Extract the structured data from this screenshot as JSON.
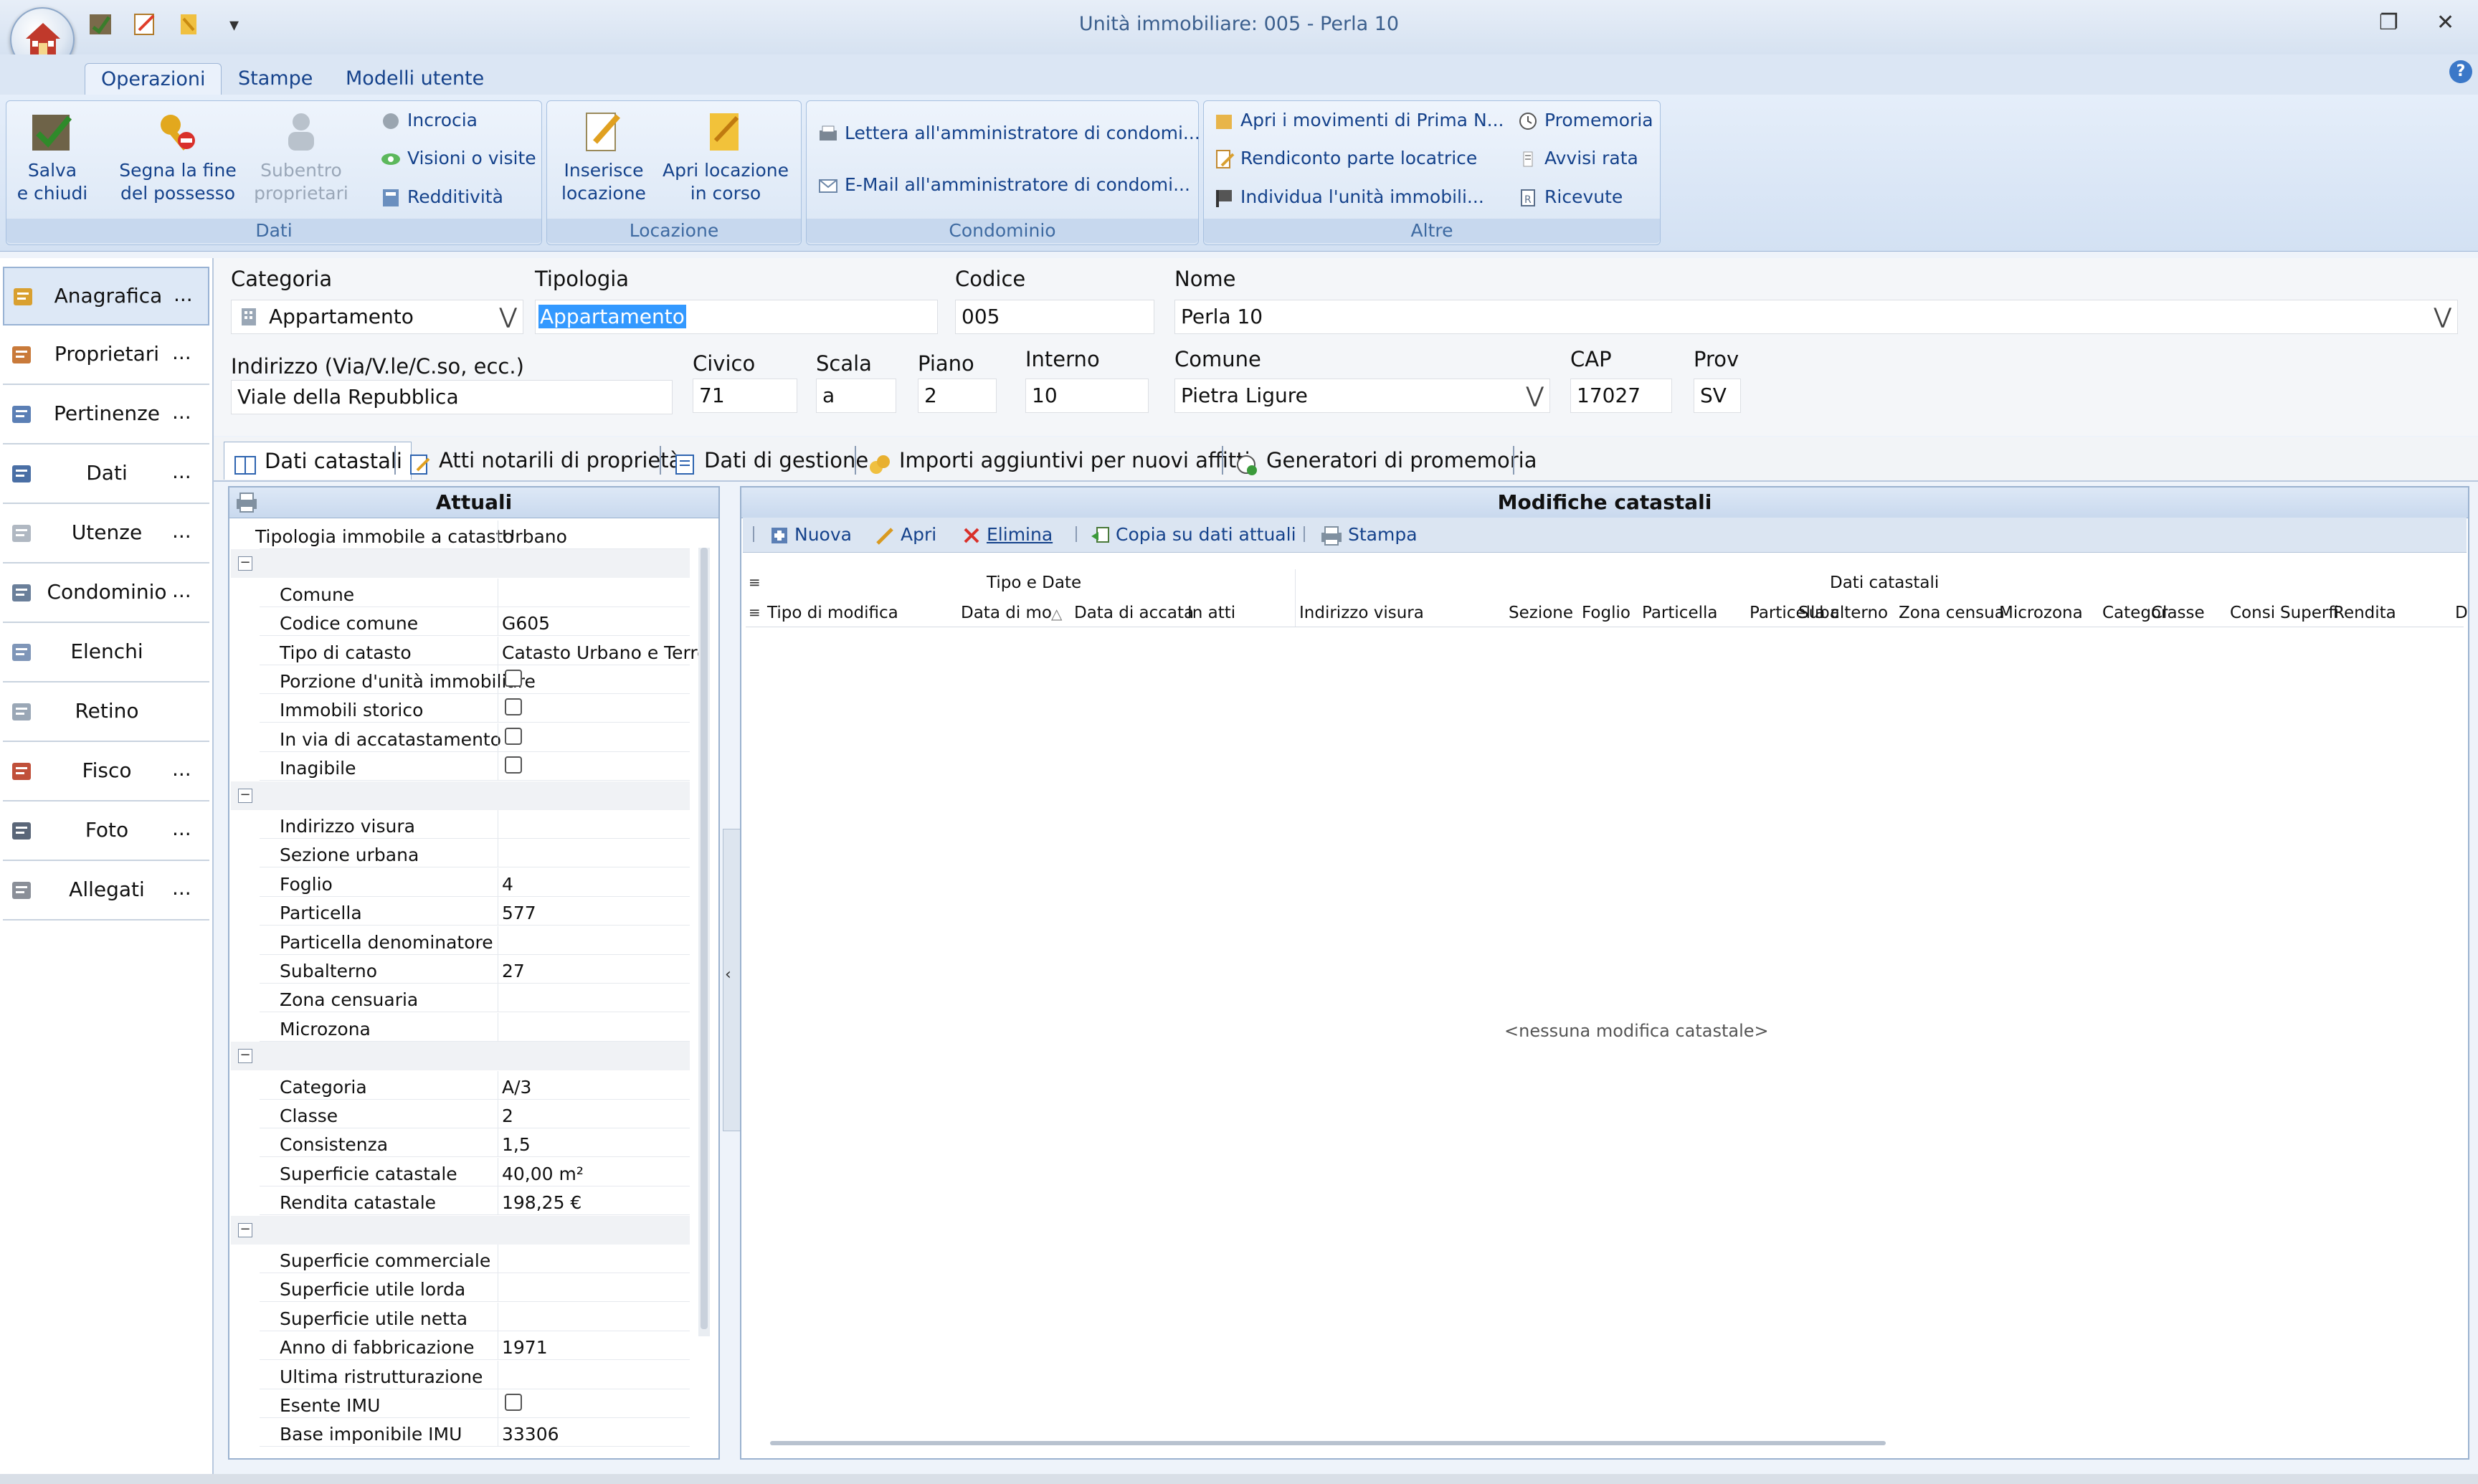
{
  "window": {
    "title": "Unità immobiliare: 005 - Perla 10",
    "restore_glyph": "❐",
    "close_glyph": "✕"
  },
  "qat": {
    "more_glyph": "▾"
  },
  "ribbon": {
    "tabs": [
      {
        "label": "Operazioni"
      },
      {
        "label": "Stampe"
      },
      {
        "label": "Modelli utente"
      }
    ],
    "help_label": "?",
    "groups": {
      "dati": {
        "label": "Dati",
        "salva": "Salva e chiudi",
        "segna": "Segna la fine del possesso",
        "subentro": "Subentro proprietari",
        "incrocia": "Incrocia",
        "visioni": "Visioni o visite",
        "redditivita": "Redditività"
      },
      "locazione": {
        "label": "Locazione",
        "inserisce": "Inserisce locazione",
        "apri": "Apri locazione in corso"
      },
      "condominio": {
        "label": "Condominio",
        "lettera": "Lettera all'amministratore di condomi...",
        "email": "E-Mail all'amministratore di condomi..."
      },
      "altre": {
        "label": "Altre",
        "movimenti": "Apri i movimenti di Prima N...",
        "rendiconto": "Rendiconto parte locatrice",
        "individua": "Individua l'unità immobili...",
        "promemoria": "Promemoria",
        "avvisi": "Avvisi rata",
        "ricevute": "Ricevute"
      }
    }
  },
  "sidebar": {
    "items": [
      {
        "label": "Anagrafica",
        "dots": "..."
      },
      {
        "label": "Proprietari",
        "dots": "..."
      },
      {
        "label": "Pertinenze",
        "dots": "..."
      },
      {
        "label": "Dati",
        "dots": "..."
      },
      {
        "label": "Utenze",
        "dots": "..."
      },
      {
        "label": "Condominio",
        "dots": "..."
      },
      {
        "label": "Elenchi",
        "dots": ""
      },
      {
        "label": "Retino",
        "dots": ""
      },
      {
        "label": "Fisco",
        "dots": "..."
      },
      {
        "label": "Foto",
        "dots": "..."
      },
      {
        "label": "Allegati",
        "dots": "..."
      }
    ]
  },
  "form": {
    "categoria": {
      "label": "Categoria",
      "value": "Appartamento"
    },
    "tipologia": {
      "label": "Tipologia",
      "value": "Appartamento"
    },
    "codice": {
      "label": "Codice",
      "value": "005"
    },
    "nome": {
      "label": "Nome",
      "value": "Perla 10"
    },
    "indirizzo": {
      "label": "Indirizzo (Via/V.le/C.so, ecc.)",
      "value": "Viale della Repubblica"
    },
    "civico": {
      "label": "Civico",
      "value": "71"
    },
    "scala": {
      "label": "Scala",
      "value": "a"
    },
    "piano": {
      "label": "Piano",
      "value": "2"
    },
    "interno": {
      "label": "Interno",
      "value": "10"
    },
    "comune": {
      "label": "Comune",
      "value": "Pietra Ligure"
    },
    "cap": {
      "label": "CAP",
      "value": "17027"
    },
    "prov": {
      "label": "Prov",
      "value": "SV"
    },
    "dropdown_glyph": "⋁"
  },
  "tabs": [
    {
      "label": "Dati catastali"
    },
    {
      "label": "Atti notarili di proprietà"
    },
    {
      "label": "Dati di gestione"
    },
    {
      "label": "Importi aggiuntivi per nuovi affitti"
    },
    {
      "label": "Generatori di promemoria"
    }
  ],
  "attuali": {
    "title": "Attuali",
    "tipologia_label": "Tipologia immobile a catasto",
    "tipologia_value": "Urbano",
    "minus_glyph": "−",
    "section1": [
      {
        "label": "Comune",
        "value": ""
      },
      {
        "label": "Codice comune",
        "value": "G605"
      },
      {
        "label": "Tipo di catasto",
        "value": "Catasto Urbano e Terre"
      }
    ],
    "checks1": [
      {
        "label": "Porzione d'unità immobiliare"
      },
      {
        "label": "Immobili storico"
      },
      {
        "label": "In via di accatastamento"
      },
      {
        "label": "Inagibile"
      }
    ],
    "section2": [
      {
        "label": "Indirizzo visura",
        "value": ""
      },
      {
        "label": "Sezione urbana",
        "value": ""
      },
      {
        "label": "Foglio",
        "value": "4"
      },
      {
        "label": "Particella",
        "value": "577"
      },
      {
        "label": "Particella denominatore",
        "value": ""
      },
      {
        "label": "Subalterno",
        "value": "27"
      },
      {
        "label": "Zona censuaria",
        "value": ""
      },
      {
        "label": "Microzona",
        "value": ""
      }
    ],
    "section3": [
      {
        "label": "Categoria",
        "value": "A/3"
      },
      {
        "label": "Classe",
        "value": "2"
      },
      {
        "label": "Consistenza",
        "value": "1,5"
      },
      {
        "label": "Superficie catastale",
        "value": "40,00 m²"
      },
      {
        "label": "Rendita catastale",
        "value": "198,25 €"
      }
    ],
    "section4": [
      {
        "label": "Superficie commerciale",
        "value": ""
      },
      {
        "label": "Superficie utile lorda",
        "value": ""
      },
      {
        "label": "Superficie utile netta",
        "value": ""
      },
      {
        "label": "Anno di fabbricazione",
        "value": "1971"
      },
      {
        "label": "Ultima ristrutturazione",
        "value": ""
      }
    ],
    "esente_label": "Esente IMU",
    "base_label": "Base imponibile IMU",
    "base_value": "33306"
  },
  "modifiche": {
    "title": "Modifiche catastali",
    "toolbar": {
      "nuova": "Nuova",
      "apri": "Apri",
      "elimina": "Elimina",
      "copia": "Copia su dati attuali",
      "stampa": "Stampa"
    },
    "band_tipo": "Tipo e Date",
    "band_dati": "Dati catastali",
    "columns": [
      "Tipo di modifica",
      "Data di mo",
      "Data di accata",
      "In atti",
      "Indirizzo visura",
      "Sezione",
      "Foglio",
      "Particella",
      "Particella c",
      "Subalterno",
      "Zona censua",
      "Microzona",
      "Categor",
      "Classe",
      "Consi",
      "Superfi",
      "Rendita",
      "D"
    ],
    "sort_glyph": "△",
    "empty_text": "<nessuna modifica catastale>"
  }
}
